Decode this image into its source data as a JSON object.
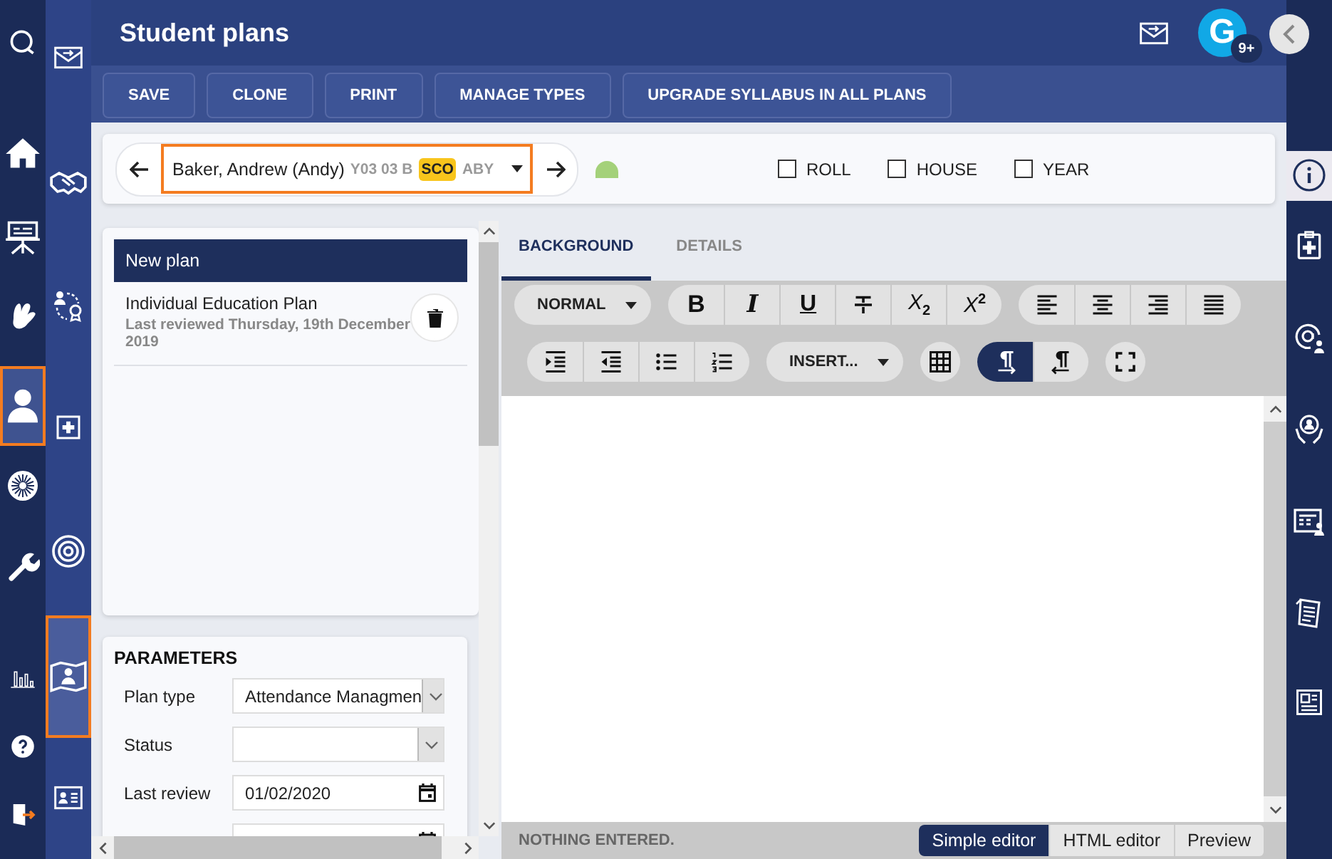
{
  "left_rail": [
    {
      "selected": false
    },
    {
      "selected": false
    },
    {
      "selected": false
    },
    {
      "selected": false
    },
    {
      "selected": true
    },
    {
      "selected": false
    },
    {
      "selected": false
    },
    {
      "selected": false
    },
    {
      "selected": false
    },
    {
      "selected": false
    }
  ],
  "second_rail": [
    {
      "selected": false
    },
    {
      "selected": false
    },
    {
      "selected": false
    },
    {
      "selected": false
    },
    {
      "selected": false
    },
    {
      "selected": true
    },
    {
      "selected": false
    }
  ],
  "header": {
    "title": "Student plans",
    "avatar_initial": "G",
    "notification_badge": "9+"
  },
  "toolbar": [
    "SAVE",
    "CLONE",
    "PRINT",
    "MANAGE TYPES",
    "UPGRADE SYLLABUS IN ALL PLANS"
  ],
  "student_bar": {
    "name": "Baker, Andrew (Andy)",
    "year": "Y03 03 B",
    "badge": "SCO",
    "house": "ABY",
    "filters": [
      {
        "label": "ROLL",
        "checked": false
      },
      {
        "label": "HOUSE",
        "checked": false
      },
      {
        "label": "YEAR",
        "checked": false
      }
    ]
  },
  "plans": {
    "header": "New plan",
    "items": [
      {
        "title": "Individual Education Plan",
        "subtitle": "Last reviewed Thursday, 19th December 2019"
      }
    ]
  },
  "parameters": {
    "title": "PARAMETERS",
    "fields": [
      {
        "kind": "select",
        "label": "Plan type",
        "value": "Attendance Managmen"
      },
      {
        "kind": "select",
        "label": "Status"
      },
      {
        "kind": "date",
        "label": "Last review",
        "value": "01/02/2020"
      },
      {
        "kind": "date"
      }
    ]
  },
  "editor": {
    "tabs": [
      {
        "label": "BACKGROUND",
        "selected": true
      },
      {
        "label": "DETAILS",
        "selected": false
      }
    ],
    "toolbar": [
      [
        {
          "kind": "dropdown",
          "label": "NORMAL"
        },
        {
          "kind": "group",
          "buttons": [
            {
              "kind": "bold",
              "label": "B"
            },
            {
              "kind": "italic",
              "label": "I"
            },
            {
              "kind": "underline",
              "label": "U"
            },
            {
              "kind": "strikethrough"
            },
            {
              "kind": "subscript",
              "label": "X$_{2}$"
            },
            {
              "kind": "superscript",
              "label": "X$^{2}$"
            }
          ]
        },
        {
          "kind": "group",
          "buttons": [
            {
              "kind": "align-left"
            },
            {
              "kind": "align-center"
            },
            {
              "kind": "align-right"
            },
            {
              "kind": "justify"
            }
          ]
        }
      ],
      [
        {
          "kind": "group",
          "buttons": [
            {
              "kind": "indent"
            },
            {
              "kind": "outdent"
            },
            {
              "kind": "bullet-list"
            },
            {
              "kind": "numbered-list"
            }
          ]
        },
        {
          "kind": "dropdown",
          "label": "INSERT..."
        },
        {
          "kind": "group",
          "buttons": [
            {
              "kind": "table"
            }
          ]
        },
        {
          "kind": "group",
          "buttons": [
            {
              "kind": "ltr",
              "selected": true
            },
            {
              "kind": "rtl",
              "selected": false
            }
          ]
        },
        {
          "kind": "group",
          "buttons": [
            {
              "kind": "fullscreen"
            }
          ]
        }
      ]
    ],
    "status": "NOTHING ENTERED.",
    "modes": [
      {
        "label": "Simple editor",
        "selected": true
      },
      {
        "label": "HTML editor",
        "selected": false
      },
      {
        "label": "Preview",
        "selected": false
      }
    ]
  },
  "right_rail": [
    {
      "selected": true
    },
    {
      "selected": false
    },
    {
      "selected": false
    },
    {
      "selected": false
    },
    {
      "selected": false
    },
    {
      "selected": false
    },
    {
      "selected": false
    }
  ]
}
